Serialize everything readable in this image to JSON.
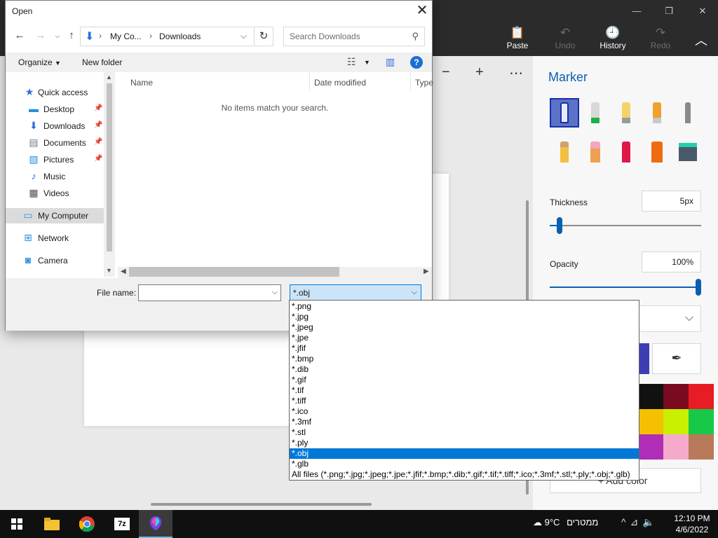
{
  "paint_app": {
    "ribbon": {
      "paste": "Paste",
      "undo": "Undo",
      "history": "History",
      "redo": "Redo"
    },
    "panel": {
      "title": "Marker",
      "thickness_label": "Thickness",
      "thickness_value": "5px",
      "thickness_level": 0.05,
      "opacity_label": "Opacity",
      "opacity_value": "100%",
      "opacity_level": 1.0,
      "add_color": "Add color",
      "accent_color": "#0b5fb3",
      "swatches": [
        "#111111",
        "#7a0a20",
        "#e81c24",
        "#f4c000",
        "#c8f000",
        "#18c848",
        "#b02db8",
        "#f5aacb",
        "#b87a5a"
      ]
    }
  },
  "dialog": {
    "title": "Open",
    "address": {
      "crumb1": "My Co...",
      "crumb2": "Downloads"
    },
    "search_placeholder": "Search Downloads",
    "toolbar": {
      "organize": "Organize",
      "new_folder": "New folder"
    },
    "nav_items": [
      {
        "label": "Quick access",
        "icon": "star-icon"
      },
      {
        "label": "Desktop",
        "icon": "desktop-icon"
      },
      {
        "label": "Downloads",
        "icon": "download-icon"
      },
      {
        "label": "Documents",
        "icon": "document-icon"
      },
      {
        "label": "Pictures",
        "icon": "pictures-icon"
      },
      {
        "label": "Music",
        "icon": "music-icon"
      },
      {
        "label": "Videos",
        "icon": "videos-icon"
      },
      {
        "label": "My Computer",
        "icon": "computer-icon"
      },
      {
        "label": "Network",
        "icon": "network-icon"
      },
      {
        "label": "Camera",
        "icon": "camera-icon"
      }
    ],
    "columns": [
      "Name",
      "Date modified",
      "Type"
    ],
    "empty_message": "No items match your search.",
    "filename_label": "File name:",
    "filename_value": "",
    "filetype_value": "*.obj",
    "filetype_options": [
      "*.png",
      "*.jpg",
      "*.jpeg",
      "*.jpe",
      "*.jfif",
      "*.bmp",
      "*.dib",
      "*.gif",
      "*.tif",
      "*.tiff",
      "*.ico",
      "*.3mf",
      "*.stl",
      "*.ply",
      "*.obj",
      "*.glb",
      "All files (*.png;*.jpg;*.jpeg;*.jpe;*.jfif;*.bmp;*.dib;*.gif;*.tif;*.tiff;*.ico;*.3mf;*.stl;*.ply;*.obj;*.glb)"
    ],
    "filetype_selected_index": 14
  },
  "taskbar": {
    "temperature": "9°C",
    "weather_text": "ממטרים",
    "time": "12:10 PM",
    "date": "4/6/2022"
  }
}
